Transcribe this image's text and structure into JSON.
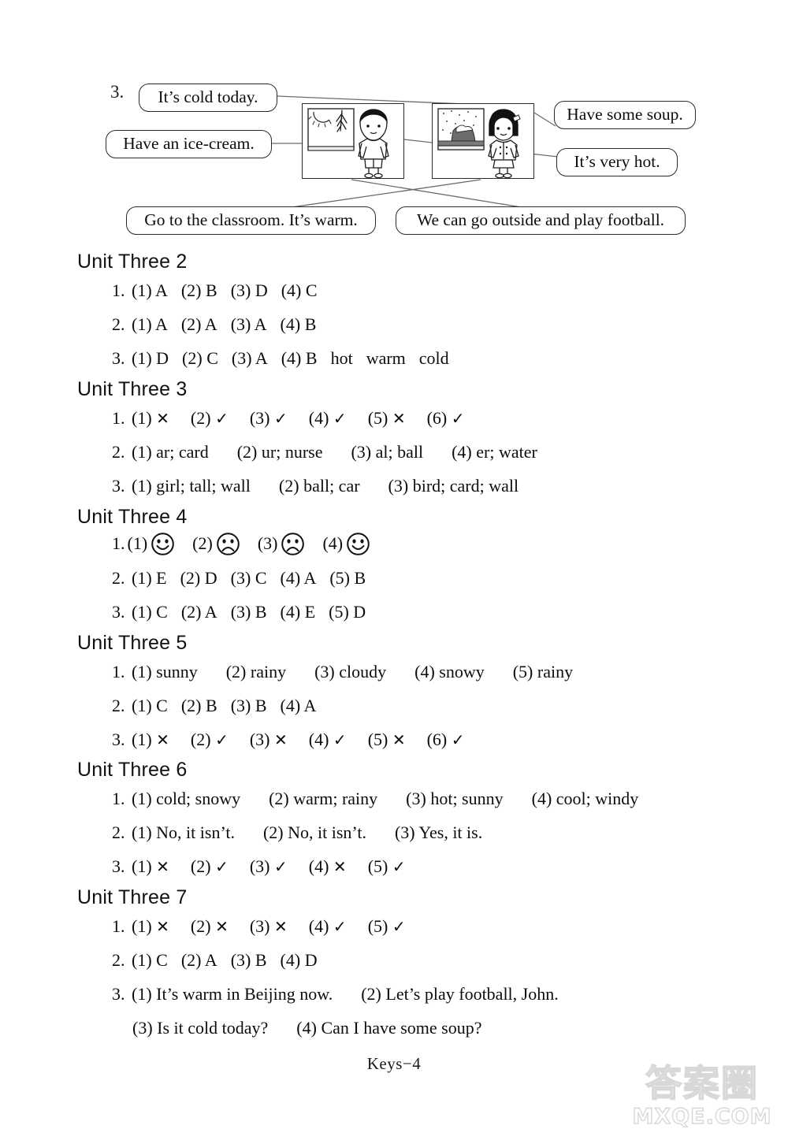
{
  "exercise": {
    "number": "3.",
    "bubbles": [
      {
        "id": "cold-today",
        "text": "It’s cold today."
      },
      {
        "id": "ice-cream",
        "text": "Have an ice-cream."
      },
      {
        "id": "some-soup",
        "text": "Have some soup."
      },
      {
        "id": "very-hot",
        "text": "It’s very hot."
      },
      {
        "id": "classroom-warm",
        "text": "Go to the classroom. It’s warm."
      },
      {
        "id": "outside-football",
        "text": "We can go outside and play football."
      }
    ],
    "pictures": [
      {
        "id": "boy-sunny-window",
        "alt": "Boy standing beside a window showing sun and tree branches"
      },
      {
        "id": "girl-snowy-window",
        "alt": "Girl standing beside a window showing snow falling outside"
      }
    ]
  },
  "units": [
    {
      "heading": "Unit Three 2",
      "lines": [
        {
          "num": "1.",
          "indent": false,
          "items": [
            {
              "label": "(1)",
              "value": "A"
            },
            {
              "label": "(2)",
              "value": "B"
            },
            {
              "label": "(3)",
              "value": "D"
            },
            {
              "label": "(4)",
              "value": "C"
            }
          ]
        },
        {
          "num": "2.",
          "indent": false,
          "items": [
            {
              "label": "(1)",
              "value": "A"
            },
            {
              "label": "(2)",
              "value": "A"
            },
            {
              "label": "(3)",
              "value": "A"
            },
            {
              "label": "(4)",
              "value": "B"
            }
          ]
        },
        {
          "num": "3.",
          "indent": false,
          "items": [
            {
              "label": "(1)",
              "value": "D"
            },
            {
              "label": "(2)",
              "value": "C"
            },
            {
              "label": "(3)",
              "value": "A"
            },
            {
              "label": "(4)",
              "value": "B"
            },
            {
              "label": "",
              "value": "hot"
            },
            {
              "label": "",
              "value": "warm"
            },
            {
              "label": "",
              "value": "cold"
            }
          ]
        }
      ]
    },
    {
      "heading": "Unit Three 3",
      "lines": [
        {
          "num": "1.",
          "indent": false,
          "items": [
            {
              "label": "(1)",
              "value": "✕"
            },
            {
              "label": "(2)",
              "value": "✓"
            },
            {
              "label": "(3)",
              "value": "✓"
            },
            {
              "label": "(4)",
              "value": "✓"
            },
            {
              "label": "(5)",
              "value": "✕"
            },
            {
              "label": "(6)",
              "value": "✓"
            }
          ]
        },
        {
          "num": "2.",
          "indent": false,
          "items": [
            {
              "label": "(1)",
              "value": "ar; card"
            },
            {
              "label": "(2)",
              "value": "ur; nurse"
            },
            {
              "label": "(3)",
              "value": "al; ball"
            },
            {
              "label": "(4)",
              "value": "er; water"
            }
          ]
        },
        {
          "num": "3.",
          "indent": false,
          "items": [
            {
              "label": "(1)",
              "value": "girl; tall; wall"
            },
            {
              "label": "(2)",
              "value": "ball; car"
            },
            {
              "label": "(3)",
              "value": "bird; card; wall"
            }
          ]
        }
      ]
    },
    {
      "heading": "Unit Three 4",
      "lines": [
        {
          "num": "1.",
          "indent": false,
          "faces": [
            {
              "label": "(1)",
              "face": "happy-face-icon"
            },
            {
              "label": "(2)",
              "face": "sad-face-icon"
            },
            {
              "label": "(3)",
              "face": "sad-face-icon"
            },
            {
              "label": "(4)",
              "face": "happy-face-icon"
            }
          ]
        },
        {
          "num": "2.",
          "indent": false,
          "items": [
            {
              "label": "(1)",
              "value": "E"
            },
            {
              "label": "(2)",
              "value": "D"
            },
            {
              "label": "(3)",
              "value": "C"
            },
            {
              "label": "(4)",
              "value": "A"
            },
            {
              "label": "(5)",
              "value": "B"
            }
          ]
        },
        {
          "num": "3.",
          "indent": false,
          "items": [
            {
              "label": "(1)",
              "value": "C"
            },
            {
              "label": "(2)",
              "value": "A"
            },
            {
              "label": "(3)",
              "value": "B"
            },
            {
              "label": "(4)",
              "value": "E"
            },
            {
              "label": "(5)",
              "value": "D"
            }
          ]
        }
      ]
    },
    {
      "heading": "Unit Three 5",
      "lines": [
        {
          "num": "1.",
          "indent": false,
          "items": [
            {
              "label": "(1)",
              "value": "sunny"
            },
            {
              "label": "(2)",
              "value": "rainy"
            },
            {
              "label": "(3)",
              "value": "cloudy"
            },
            {
              "label": "(4)",
              "value": "snowy"
            },
            {
              "label": "(5)",
              "value": "rainy"
            }
          ]
        },
        {
          "num": "2.",
          "indent": false,
          "items": [
            {
              "label": "(1)",
              "value": "C"
            },
            {
              "label": "(2)",
              "value": "B"
            },
            {
              "label": "(3)",
              "value": "B"
            },
            {
              "label": "(4)",
              "value": "A"
            }
          ]
        },
        {
          "num": "3.",
          "indent": false,
          "items": [
            {
              "label": "(1)",
              "value": "✕"
            },
            {
              "label": "(2)",
              "value": "✓"
            },
            {
              "label": "(3)",
              "value": "✕"
            },
            {
              "label": "(4)",
              "value": "✓"
            },
            {
              "label": "(5)",
              "value": "✕"
            },
            {
              "label": "(6)",
              "value": "✓"
            }
          ]
        }
      ]
    },
    {
      "heading": "Unit Three 6",
      "lines": [
        {
          "num": "1.",
          "indent": false,
          "items": [
            {
              "label": "(1)",
              "value": "cold; snowy"
            },
            {
              "label": "(2)",
              "value": "warm; rainy"
            },
            {
              "label": "(3)",
              "value": "hot; sunny"
            },
            {
              "label": "(4)",
              "value": "cool; windy"
            }
          ]
        },
        {
          "num": "2.",
          "indent": false,
          "items": [
            {
              "label": "(1)",
              "value": "No, it isn’t."
            },
            {
              "label": "(2)",
              "value": "No, it isn’t."
            },
            {
              "label": "(3)",
              "value": "Yes, it is."
            }
          ]
        },
        {
          "num": "3.",
          "indent": false,
          "items": [
            {
              "label": "(1)",
              "value": "✕"
            },
            {
              "label": "(2)",
              "value": "✓"
            },
            {
              "label": "(3)",
              "value": "✓"
            },
            {
              "label": "(4)",
              "value": "✕"
            },
            {
              "label": "(5)",
              "value": "✓"
            }
          ]
        }
      ]
    },
    {
      "heading": "Unit Three 7",
      "lines": [
        {
          "num": "1.",
          "indent": false,
          "items": [
            {
              "label": "(1)",
              "value": "✕"
            },
            {
              "label": "(2)",
              "value": "✕"
            },
            {
              "label": "(3)",
              "value": "✕"
            },
            {
              "label": "(4)",
              "value": "✓"
            },
            {
              "label": "(5)",
              "value": "✓"
            }
          ]
        },
        {
          "num": "2.",
          "indent": false,
          "items": [
            {
              "label": "(1)",
              "value": "C"
            },
            {
              "label": "(2)",
              "value": "A"
            },
            {
              "label": "(3)",
              "value": "B"
            },
            {
              "label": "(4)",
              "value": "D"
            }
          ]
        },
        {
          "num": "3.",
          "indent": false,
          "items": [
            {
              "label": "(1)",
              "value": "It’s warm in Beijing now."
            },
            {
              "label": "(2)",
              "value": "Let’s play football, John."
            }
          ]
        },
        {
          "num": "",
          "indent": true,
          "items": [
            {
              "label": "(3)",
              "value": "Is it cold today?"
            },
            {
              "label": "(4)",
              "value": "Can I have some soup?"
            }
          ]
        }
      ]
    }
  ],
  "footer": {
    "page_label": "Keys−4"
  },
  "watermark": {
    "chinese": "答案圈",
    "site": "MXQE.COM"
  }
}
